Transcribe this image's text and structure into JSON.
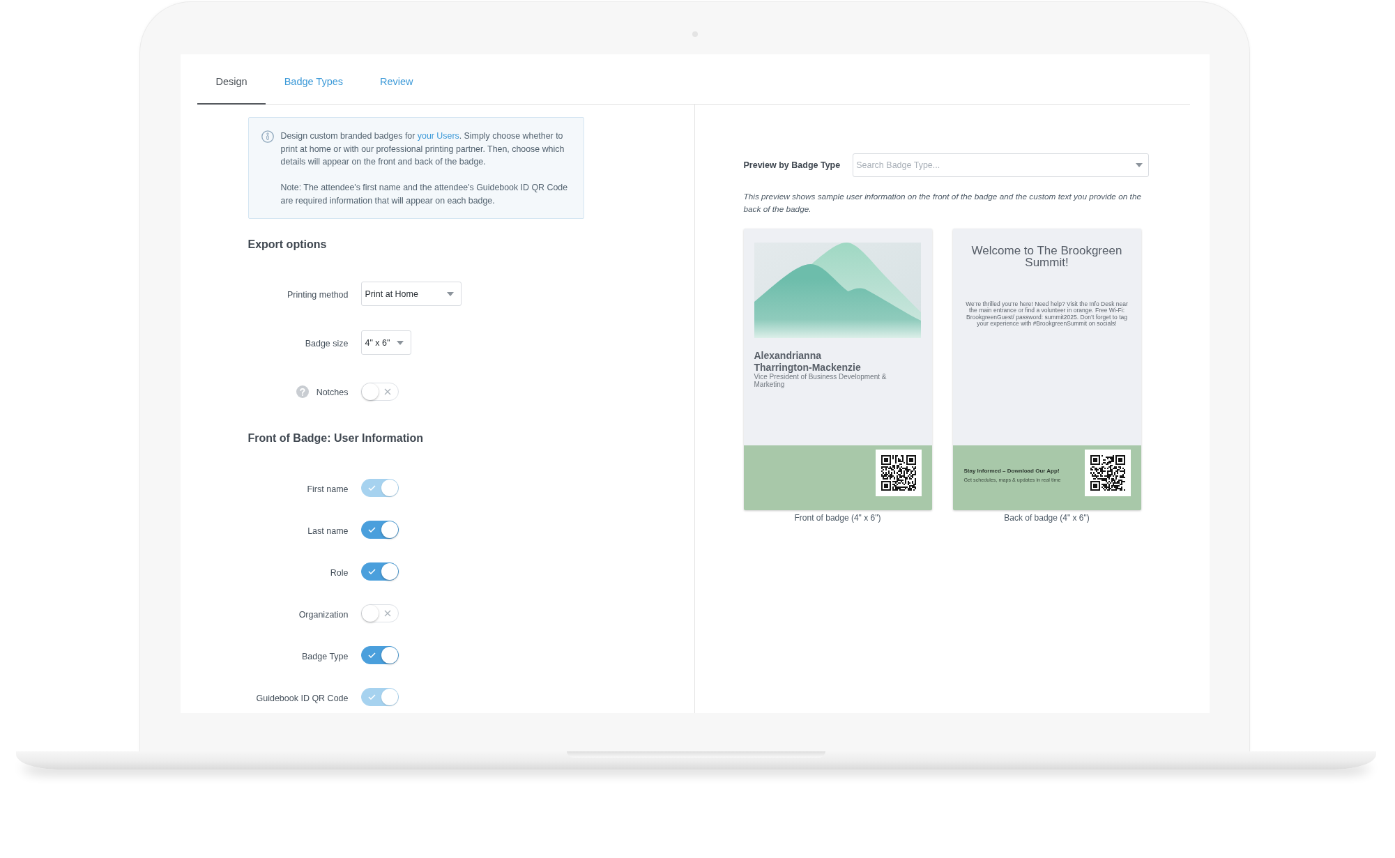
{
  "tabs": [
    {
      "label": "Design",
      "selected": true
    },
    {
      "label": "Badge Types",
      "selected": false
    },
    {
      "label": "Review",
      "selected": false
    }
  ],
  "info_box": {
    "intro": {
      "before": "Design custom branded badges for ",
      "link": "your Users",
      "after": ". Simply choose whether to print at home or with our professional printing partner. Then, choose which details will appear on the front and back of the badge."
    },
    "note": "Note: The attendee's first name and the attendee's Guidebook ID QR Code are required information that will appear on each badge."
  },
  "export_options": {
    "title": "Export options",
    "fields": [
      {
        "kind": "select",
        "label": "Printing method",
        "value": "Print at Home",
        "help": false
      },
      {
        "kind": "select",
        "label": "Badge size",
        "value": "4\" x 6\"",
        "help": false
      },
      {
        "kind": "toggle",
        "label": "Notches",
        "help": true,
        "on": false,
        "disabled": false
      }
    ]
  },
  "front_of_badge": {
    "title": "Front of Badge: User Information",
    "fields": [
      {
        "kind": "toggle",
        "label": "First name",
        "help": false,
        "on": true,
        "disabled": true
      },
      {
        "kind": "toggle",
        "label": "Last name",
        "help": false,
        "on": true,
        "disabled": false
      },
      {
        "kind": "toggle",
        "label": "Role",
        "help": false,
        "on": true,
        "disabled": false
      },
      {
        "kind": "toggle",
        "label": "Organization",
        "help": false,
        "on": false,
        "disabled": false
      },
      {
        "kind": "toggle",
        "label": "Badge Type",
        "help": false,
        "on": true,
        "disabled": false
      },
      {
        "kind": "toggle",
        "label": "Guidebook ID QR Code",
        "help": false,
        "on": true,
        "disabled": true
      }
    ]
  },
  "preview": {
    "label": "Preview by Badge Type",
    "search": {
      "placeholder": "Search Badge Type..."
    },
    "description": "This preview shows sample user information on the front of the badge and the custom text you provide on the back of the badge.",
    "front": {
      "name": "Alexandrianna Tharrington-Mackenzie",
      "role": "Vice President of Business Development & Marketing",
      "caption": "Front of badge (4\" x 6\")"
    },
    "back": {
      "title": "Welcome to The Brookgreen Summit!",
      "message": "We’re thrilled you’re here! Need help? Visit the Info Desk near the main entrance or find a volunteer in orange. Free Wi-Fi: BrookgreenGuest/ password: summit2025. Don’t forget to tag your experience with #BrookgreenSummit on socials!",
      "footer_title": "Stay Informed – Download Our App!",
      "footer_text": "Get schedules, maps & updates in real time",
      "caption": "Back of badge (4\" x 6\")"
    }
  }
}
